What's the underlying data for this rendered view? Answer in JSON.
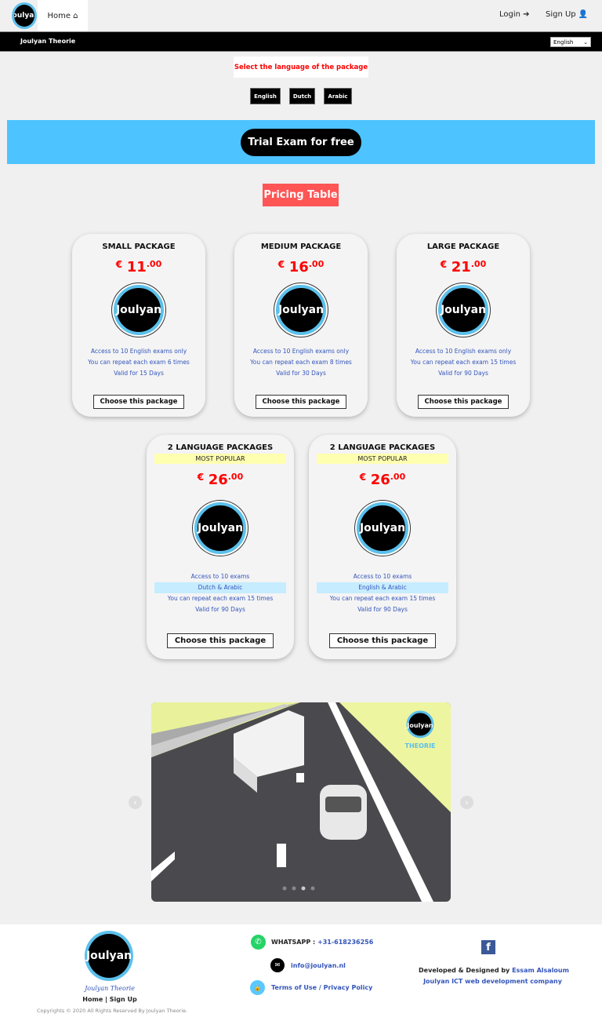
{
  "nav": {
    "logo_text": "Joulyan",
    "home": "Home",
    "login": "Login",
    "signup": "Sign Up"
  },
  "bar": {
    "brand": "Joulyan Theorie",
    "language_select": "English"
  },
  "language_prompt": "Select the language of the package",
  "languages": [
    "English",
    "Dutch",
    "Arabic"
  ],
  "trial_button": "Trial Exam for free",
  "pricing_title": "Pricing Table",
  "packages": [
    {
      "title": "SMALL PACKAGE",
      "currency": "€",
      "price": "11",
      "decimals": ".00",
      "logo": "Joulyan",
      "features": [
        "Access to 10 English exams only",
        "You can repeat each exam 6 times",
        "Valid for 15 Days"
      ],
      "button": "Choose this package"
    },
    {
      "title": "MEDIUM PACKAGE",
      "currency": "€",
      "price": "16",
      "decimals": ".00",
      "logo": "Joulyan",
      "features": [
        "Access to 10 English exams only",
        "You can repeat each exam 8 times",
        "Valid for 30 Days"
      ],
      "button": "Choose this package"
    },
    {
      "title": "LARGE PACKAGE",
      "currency": "€",
      "price": "21",
      "decimals": ".00",
      "logo": "Joulyan",
      "features": [
        "Access to 10 English exams only",
        "You can repeat each exam 15 times",
        "Valid for 90 Days"
      ],
      "button": "Choose this package"
    },
    {
      "title": "2 LANGUAGE PACKAGES",
      "badge": "MOST POPULAR",
      "currency": "€",
      "price": "26",
      "decimals": ".00",
      "logo": "Joulyan",
      "features": [
        "Access to 10 exams",
        "Dutch & Arabic",
        "You can repeat each exam 15 times",
        "Valid for 90 Days"
      ],
      "button": "Choose this package"
    },
    {
      "title": "2 LANGUAGE PACKAGES",
      "badge": "MOST POPULAR",
      "currency": "€",
      "price": "26",
      "decimals": ".00",
      "logo": "Joulyan",
      "features": [
        "Access to 10 exams",
        "English & Arabic",
        "You can repeat each exam 15 times",
        "Valid for 90 Days"
      ],
      "button": "Choose this package"
    }
  ],
  "carousel": {
    "prev": "‹",
    "next": "›",
    "slides": 4,
    "active": 3,
    "watermark": "THEORIE"
  },
  "footer": {
    "logo": "Joulyan",
    "brand_script": "Joulyan Theorie",
    "home": "Home",
    "sep": "|",
    "signup": "Sign Up",
    "copyright": "Copyrights © 2020 All Rights Reserved By Joulyan Theorie.",
    "whatsapp_label": "WHATSAPP :",
    "whatsapp": "+31-618236256",
    "email": "info@joulyan.nl",
    "terms": "Terms of Use / Privacy Policy",
    "dev_label": "Developed & Designed by",
    "dev_name": "Essam Alsaloum",
    "company": "Joulyan ICT web development company",
    "colors": {
      "whatsapp": "#25d366",
      "accent": "#3355bb",
      "facebook": "#3b5998"
    }
  }
}
